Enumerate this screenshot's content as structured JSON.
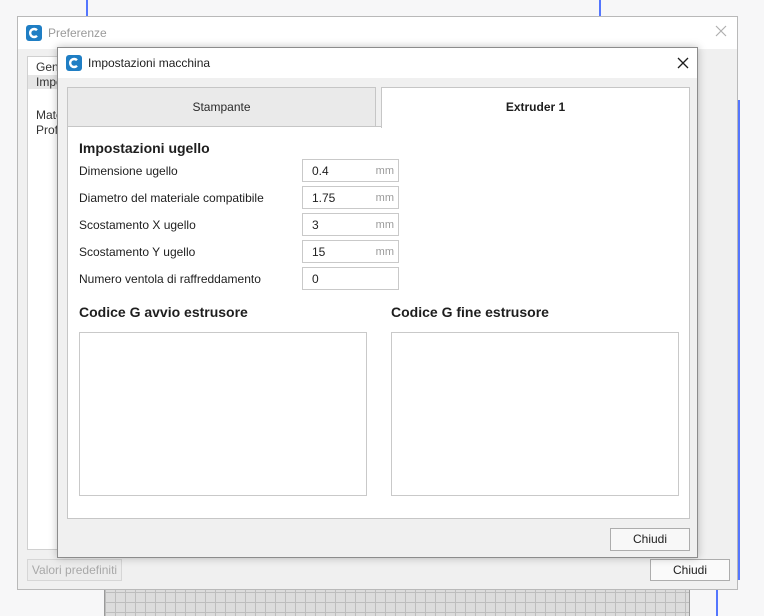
{
  "background_window": {
    "title": "Preferenze",
    "sidebar_items": [
      "Gen",
      "Impo",
      "Mate",
      "Prof"
    ],
    "defaults_button": "Valori predefiniti",
    "close_button": "Chiudi"
  },
  "dialog": {
    "title": "Impostazioni macchina",
    "tabs": [
      {
        "label": "Stampante",
        "active": false
      },
      {
        "label": "Extruder 1",
        "active": true
      }
    ],
    "nozzle_section_title": "Impostazioni ugello",
    "fields": [
      {
        "label": "Dimensione ugello",
        "value": "0.4",
        "unit": "mm"
      },
      {
        "label": "Diametro del materiale compatibile",
        "value": "1.75",
        "unit": "mm"
      },
      {
        "label": "Scostamento X ugello",
        "value": "3",
        "unit": "mm"
      },
      {
        "label": "Scostamento Y ugello",
        "value": "15",
        "unit": "mm"
      },
      {
        "label": "Numero ventola di raffreddamento",
        "value": "0",
        "unit": ""
      }
    ],
    "start_gcode_title": "Codice G avvio estrusore",
    "end_gcode_title": "Codice G fine estrusore",
    "start_gcode_value": "",
    "end_gcode_value": "",
    "close_button": "Chiudi"
  },
  "colors": {
    "brand": "#1f7ec4",
    "wireframe": "#2a55ff"
  },
  "icons": {
    "app_logo": "cura-logo-icon",
    "close": "close-icon"
  }
}
